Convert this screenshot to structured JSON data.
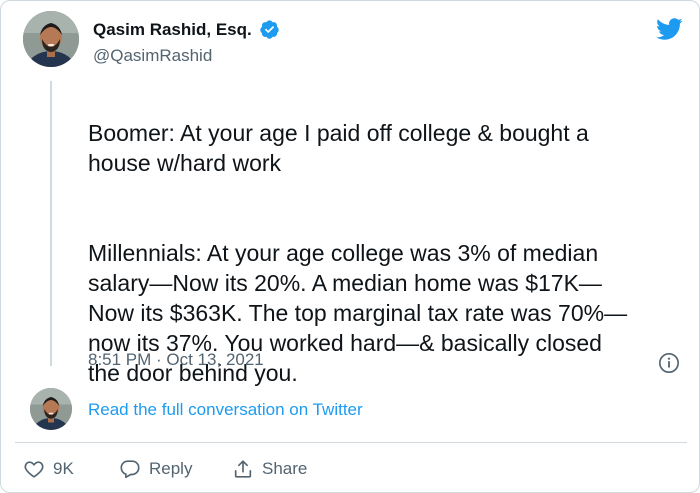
{
  "author": {
    "name": "Qasim Rashid, Esq.",
    "handle": "@QasimRashid"
  },
  "tweet": {
    "paragraph_1": "Boomer: At your age I paid off college & bought a\nhouse w/hard work",
    "paragraph_2": "Millennials: At your age college was 3% of median\nsalary—Now its 20%. A median home was $17K—\nNow its $363K. The top marginal tax rate was 70%—\nnow its 37%. You worked hard—& basically closed\nthe door behind you.",
    "timestamp": "8:51 PM · Oct 13, 2021"
  },
  "conversation": {
    "link_label": "Read the full conversation on Twitter"
  },
  "actions": {
    "like_count": "9K",
    "reply_label": "Reply",
    "share_label": "Share"
  },
  "colors": {
    "accent": "#1d9bf0",
    "muted": "#536471",
    "text": "#0f1419",
    "border": "#cfd9de"
  },
  "icons": [
    "verified-badge-icon",
    "twitter-bird-icon",
    "info-icon",
    "heart-icon",
    "reply-bubble-icon",
    "share-icon"
  ]
}
